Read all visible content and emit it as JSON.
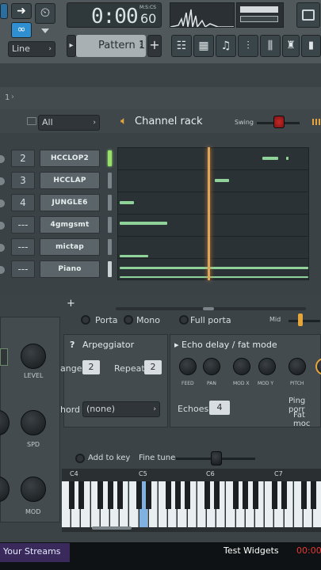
{
  "toolbar": {
    "time": "0:00",
    "time_small": "60",
    "time_unit": "M:S:CS",
    "snap_mode": "Line",
    "pattern": "Pattern 1"
  },
  "header_number": "1",
  "channel_rack": {
    "filter": "All",
    "title": "Channel rack",
    "swing_label": "Swing",
    "channels": [
      {
        "num": "2",
        "name": "HCCLOP2"
      },
      {
        "num": "3",
        "name": "HCCLAP"
      },
      {
        "num": "4",
        "name": "JUNGLE6"
      },
      {
        "num": "---",
        "name": "4gmgsmt"
      },
      {
        "num": "---",
        "name": "mictap"
      },
      {
        "num": "---",
        "name": "Piano"
      }
    ],
    "add_label": "+"
  },
  "instrument": {
    "porta": "Porta",
    "mono": "Mono",
    "full_porta": "Full porta",
    "mid": "Mid",
    "arpeggiator": "Arpeggiator",
    "range_label": "ange",
    "range_value": "2",
    "repeat_label": "Repeat",
    "repeat_value": "2",
    "chord_label": "hord",
    "chord_value": "(none)",
    "echo_title": "Echo delay / fat mode",
    "knobs": [
      "FEED",
      "PAN",
      "MOD X",
      "MOD Y",
      "PITCH"
    ],
    "echoes_label": "Echoes",
    "echoes_value": "4",
    "ping_pong": "Ping porr",
    "fat_mode": "Fat moc",
    "add_to_key": "Add to key",
    "fine_tune": "Fine tune",
    "left_knobs": [
      "LEVEL",
      "SPD",
      "MOD"
    ],
    "octaves": [
      "C4",
      "C5",
      "C6",
      "C7"
    ]
  },
  "stream_bar": {
    "left": "Your Streams",
    "center": "Test Widgets",
    "right": "00:00"
  }
}
